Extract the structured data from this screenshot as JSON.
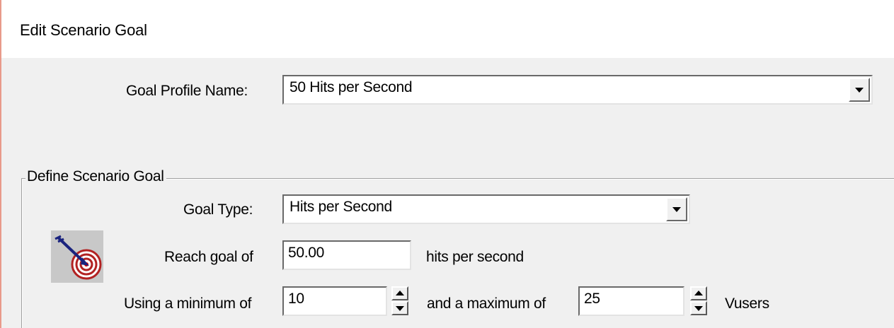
{
  "window": {
    "title": "Edit Scenario Goal"
  },
  "profile": {
    "label": "Goal Profile Name:",
    "selected": "50 Hits per Second"
  },
  "group": {
    "legend": "Define Scenario Goal",
    "goal_type_label": "Goal Type:",
    "goal_type_selected": "Hits per Second",
    "reach_label": "Reach goal of",
    "reach_value": "50.00",
    "reach_unit": "hits per second",
    "min_label": "Using a minimum of",
    "min_value": "10",
    "max_label": "and a maximum of",
    "max_value": "25",
    "max_unit": "Vusers"
  },
  "icons": {
    "goal": "target-arrow-icon"
  }
}
